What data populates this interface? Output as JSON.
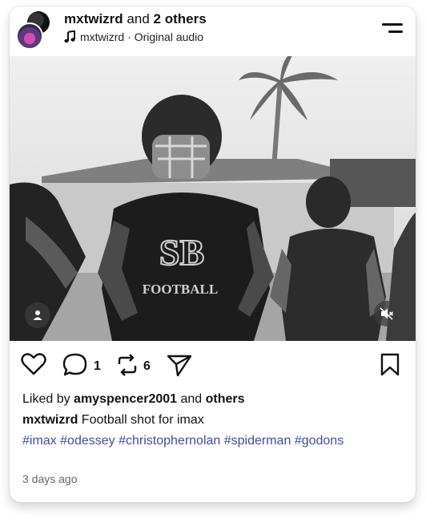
{
  "post": {
    "author": "mxtwizrd",
    "and_text": "and",
    "others_text": "2 others",
    "audio_author": "mxtwizrd",
    "audio_separator": "·",
    "audio_title": "Original audio",
    "icons": {
      "menu": "menu-lines-icon",
      "music": "music-note-icon",
      "profile": "user-icon",
      "mute": "speaker-muted-icon",
      "like": "heart-icon",
      "comment": "speech-bubble-icon",
      "repost": "repost-icon",
      "share": "paper-plane-icon",
      "save": "bookmark-icon"
    }
  },
  "media": {
    "description_colors": {
      "sky": "#e4e4e4",
      "jersey": "#1c1c1c"
    },
    "jersey_logo": "SB",
    "jersey_text": "FOOTBALL"
  },
  "actions": {
    "comment_count": "1",
    "repost_count": "6"
  },
  "likes": {
    "prefix": "Liked by",
    "user": "amyspencer2001",
    "joiner": "and",
    "others": "others"
  },
  "caption": {
    "user": "mxtwizrd",
    "text": "Football shot for imax"
  },
  "hashtags": [
    "#imax",
    "#odessey",
    "#christophernolan",
    "#spiderman",
    "#godons"
  ],
  "timestamp": "3 days ago"
}
